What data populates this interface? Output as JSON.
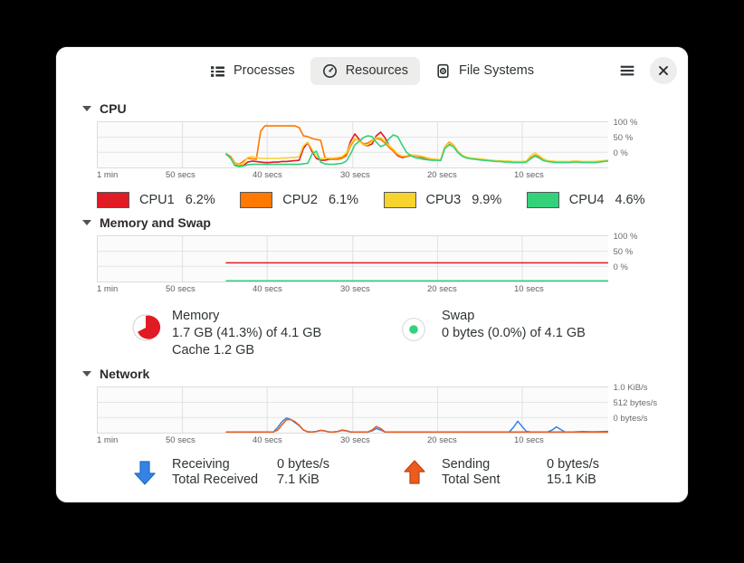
{
  "window": {
    "tabs": [
      {
        "id": "processes",
        "label": "Processes",
        "icon": "list-icon",
        "active": false
      },
      {
        "id": "resources",
        "label": "Resources",
        "icon": "speedometer-icon",
        "active": true
      },
      {
        "id": "filesystems",
        "label": "File Systems",
        "icon": "drive-icon",
        "active": false
      }
    ],
    "menu_button": "hamburger-menu-icon",
    "close_button": "close-icon"
  },
  "sections": {
    "cpu": {
      "title": "CPU",
      "expanded": true,
      "y_labels": [
        "100 %",
        "50 %",
        "0 %"
      ],
      "x_labels": [
        "1 min",
        "50 secs",
        "40 secs",
        "30 secs",
        "20 secs",
        "10 secs"
      ],
      "legend": [
        {
          "name": "CPU1",
          "value": "6.2%",
          "color": "#e01b24"
        },
        {
          "name": "CPU2",
          "value": "6.1%",
          "color": "#ff7800"
        },
        {
          "name": "CPU3",
          "value": "9.9%",
          "color": "#f6d32d"
        },
        {
          "name": "CPU4",
          "value": "4.6%",
          "color": "#33d17a"
        }
      ]
    },
    "memory": {
      "title": "Memory and Swap",
      "expanded": true,
      "y_labels": [
        "100 %",
        "50 %",
        "0 %"
      ],
      "x_labels": [
        "1 min",
        "50 secs",
        "40 secs",
        "30 secs",
        "20 secs",
        "10 secs"
      ],
      "memory": {
        "icon": "memory-pie-icon",
        "title": "Memory",
        "usage": "1.7 GB (41.3%) of 4.1 GB",
        "cache": "Cache 1.2 GB",
        "color": "#e01b24"
      },
      "swap": {
        "icon": "swap-pie-icon",
        "title": "Swap",
        "usage": "0 bytes (0.0%) of 4.1 GB",
        "color": "#33d17a"
      }
    },
    "network": {
      "title": "Network",
      "expanded": true,
      "y_labels": [
        "1.0 KiB/s",
        "512 bytes/s",
        "0 bytes/s"
      ],
      "x_labels": [
        "1 min",
        "50 secs",
        "40 secs",
        "30 secs",
        "20 secs",
        "10 secs"
      ],
      "receiving": {
        "icon": "download-arrow-icon",
        "label": "Receiving",
        "value": "0 bytes/s",
        "total_label": "Total Received",
        "total_value": "7.1 KiB",
        "color": "#3584e4"
      },
      "sending": {
        "icon": "upload-arrow-icon",
        "label": "Sending",
        "value": "0 bytes/s",
        "total_label": "Total Sent",
        "total_value": "15.1 KiB",
        "color": "#ed5b1d"
      }
    }
  },
  "chart_data": [
    {
      "type": "line",
      "title": "CPU",
      "xlabel": "",
      "ylabel": "%",
      "ylim": [
        0,
        100
      ],
      "x_ticks": [
        "1 min",
        "50 secs",
        "40 secs",
        "30 secs",
        "20 secs",
        "10 secs"
      ],
      "y_ticks": [
        "0 %",
        "50 %",
        "100 %"
      ],
      "grid": true,
      "legend_position": "below",
      "series": [
        {
          "name": "CPU1",
          "color": "#e01b24",
          "values": [
            null,
            null,
            null,
            null,
            null,
            null,
            null,
            null,
            null,
            null,
            null,
            null,
            null,
            null,
            null,
            null,
            null,
            null,
            null,
            null,
            null,
            null,
            null,
            null,
            null,
            null,
            null,
            null,
            null,
            null,
            30,
            22,
            5,
            3,
            4,
            12,
            14,
            13,
            12,
            11,
            11,
            12,
            12,
            13,
            13,
            14,
            15,
            16,
            42,
            55,
            35,
            20,
            16,
            16,
            18,
            18,
            19,
            22,
            30,
            58,
            74,
            62,
            50,
            48,
            52,
            70,
            78,
            66,
            48,
            36,
            26,
            22,
            24,
            26,
            26,
            24,
            22,
            20,
            18,
            17,
            16,
            44,
            52,
            48,
            34,
            26,
            22,
            20,
            19,
            18,
            17,
            16,
            15,
            14,
            14,
            13,
            13,
            12,
            12,
            12,
            13,
            20,
            26,
            22,
            16,
            14,
            13,
            12,
            12,
            12,
            12,
            13,
            13,
            12,
            12,
            12,
            12,
            13,
            14,
            15
          ]
        },
        {
          "name": "CPU2",
          "color": "#ff7800",
          "values": [
            null,
            null,
            null,
            null,
            null,
            null,
            null,
            null,
            null,
            null,
            null,
            null,
            null,
            null,
            null,
            null,
            null,
            null,
            null,
            null,
            null,
            null,
            null,
            null,
            null,
            null,
            null,
            null,
            null,
            null,
            30,
            24,
            10,
            7,
            14,
            20,
            19,
            18,
            80,
            92,
            92,
            92,
            92,
            92,
            92,
            92,
            92,
            88,
            70,
            68,
            64,
            62,
            60,
            22,
            19,
            18,
            18,
            20,
            26,
            48,
            62,
            60,
            52,
            54,
            60,
            64,
            62,
            54,
            44,
            36,
            28,
            24,
            25,
            27,
            26,
            25,
            23,
            20,
            18,
            17,
            16,
            46,
            56,
            50,
            36,
            27,
            22,
            20,
            19,
            18,
            17,
            16,
            15,
            14,
            14,
            13,
            13,
            12,
            12,
            12,
            13,
            21,
            27,
            23,
            17,
            14,
            13,
            12,
            12,
            12,
            12,
            13,
            13,
            12,
            12,
            12,
            12,
            13,
            14,
            15
          ]
        },
        {
          "name": "CPU3",
          "color": "#f6d32d",
          "values": [
            null,
            null,
            null,
            null,
            null,
            null,
            null,
            null,
            null,
            null,
            null,
            null,
            null,
            null,
            null,
            null,
            null,
            null,
            null,
            null,
            null,
            null,
            null,
            null,
            null,
            null,
            null,
            null,
            null,
            null,
            28,
            21,
            8,
            6,
            9,
            22,
            24,
            22,
            20,
            20,
            20,
            20,
            20,
            21,
            21,
            22,
            22,
            24,
            48,
            56,
            40,
            24,
            20,
            20,
            21,
            21,
            22,
            24,
            32,
            52,
            64,
            58,
            50,
            50,
            58,
            66,
            66,
            58,
            48,
            40,
            30,
            25,
            26,
            28,
            27,
            26,
            24,
            21,
            19,
            18,
            17,
            45,
            54,
            49,
            35,
            27,
            23,
            21,
            20,
            19,
            18,
            17,
            16,
            15,
            15,
            14,
            14,
            13,
            13,
            13,
            14,
            26,
            32,
            26,
            19,
            15,
            14,
            13,
            13,
            13,
            13,
            14,
            14,
            13,
            13,
            13,
            13,
            14,
            15,
            16
          ]
        },
        {
          "name": "CPU4",
          "color": "#33d17a",
          "values": [
            null,
            null,
            null,
            null,
            null,
            null,
            null,
            null,
            null,
            null,
            null,
            null,
            null,
            null,
            null,
            null,
            null,
            null,
            null,
            null,
            null,
            null,
            null,
            null,
            null,
            null,
            null,
            null,
            null,
            null,
            29,
            20,
            4,
            2,
            3,
            6,
            7,
            7,
            7,
            7,
            7,
            7,
            7,
            7,
            7,
            7,
            7,
            7,
            8,
            9,
            30,
            36,
            12,
            8,
            7,
            7,
            8,
            9,
            14,
            30,
            50,
            58,
            66,
            70,
            68,
            56,
            46,
            50,
            64,
            72,
            68,
            50,
            34,
            26,
            22,
            20,
            18,
            17,
            16,
            16,
            15,
            42,
            50,
            46,
            33,
            25,
            21,
            19,
            18,
            17,
            16,
            15,
            14,
            13,
            13,
            12,
            12,
            11,
            11,
            11,
            12,
            19,
            25,
            21,
            15,
            13,
            12,
            11,
            11,
            11,
            11,
            12,
            12,
            11,
            11,
            11,
            11,
            12,
            13,
            14
          ]
        }
      ]
    },
    {
      "type": "line",
      "title": "Memory and Swap",
      "xlabel": "",
      "ylabel": "%",
      "ylim": [
        0,
        100
      ],
      "x_ticks": [
        "1 min",
        "50 secs",
        "40 secs",
        "30 secs",
        "20 secs",
        "10 secs"
      ],
      "y_ticks": [
        "0 %",
        "50 %",
        "100 %"
      ],
      "grid": true,
      "series": [
        {
          "name": "Memory",
          "color": "#e01b24",
          "values_constant": 41.3,
          "start_index": 30
        },
        {
          "name": "Swap",
          "color": "#33d17a",
          "values_constant": 0.0,
          "start_index": 30
        }
      ]
    },
    {
      "type": "line",
      "title": "Network",
      "xlabel": "",
      "ylabel": "bytes/s",
      "ylim": [
        0,
        1024
      ],
      "x_ticks": [
        "1 min",
        "50 secs",
        "40 secs",
        "30 secs",
        "20 secs",
        "10 secs"
      ],
      "y_ticks": [
        "0 bytes/s",
        "512 bytes/s",
        "1.0 KiB/s"
      ],
      "grid": true,
      "series": [
        {
          "name": "Receiving",
          "color": "#3584e4",
          "values": [
            null,
            null,
            null,
            null,
            null,
            null,
            null,
            null,
            null,
            null,
            null,
            null,
            null,
            null,
            null,
            null,
            null,
            null,
            null,
            null,
            null,
            null,
            null,
            null,
            null,
            null,
            null,
            null,
            null,
            null,
            0,
            0,
            0,
            0,
            0,
            0,
            0,
            0,
            0,
            0,
            0,
            12,
            120,
            250,
            330,
            300,
            230,
            160,
            60,
            20,
            10,
            30,
            55,
            40,
            15,
            8,
            30,
            60,
            45,
            15,
            5,
            2,
            0,
            0,
            40,
            95,
            60,
            10,
            0,
            0,
            0,
            0,
            0,
            0,
            0,
            0,
            0,
            0,
            0,
            0,
            0,
            0,
            0,
            0,
            0,
            0,
            0,
            0,
            0,
            0,
            0,
            0,
            0,
            0,
            0,
            0,
            0,
            120,
            260,
            140,
            30,
            5,
            0,
            0,
            0,
            0,
            60,
            130,
            70,
            15,
            5,
            10,
            22,
            26,
            24,
            22,
            22,
            24,
            26,
            28
          ]
        },
        {
          "name": "Sending",
          "color": "#ed5b1d",
          "values": [
            null,
            null,
            null,
            null,
            null,
            null,
            null,
            null,
            null,
            null,
            null,
            null,
            null,
            null,
            null,
            null,
            null,
            null,
            null,
            null,
            null,
            null,
            null,
            null,
            null,
            null,
            null,
            null,
            null,
            null,
            0,
            0,
            0,
            0,
            0,
            0,
            0,
            0,
            0,
            0,
            0,
            5,
            60,
            180,
            290,
            300,
            250,
            170,
            60,
            18,
            8,
            26,
            50,
            38,
            12,
            6,
            26,
            52,
            40,
            12,
            4,
            2,
            0,
            0,
            60,
            140,
            95,
            18,
            0,
            0,
            0,
            0,
            0,
            0,
            0,
            0,
            0,
            0,
            0,
            0,
            0,
            0,
            0,
            0,
            0,
            0,
            0,
            0,
            0,
            0,
            0,
            0,
            0,
            0,
            0,
            0,
            0,
            0,
            0,
            0,
            0,
            0,
            0,
            0,
            0,
            0,
            0,
            0,
            0,
            0,
            0,
            0,
            0,
            0,
            0,
            0,
            0,
            0,
            0,
            0
          ]
        }
      ]
    }
  ]
}
